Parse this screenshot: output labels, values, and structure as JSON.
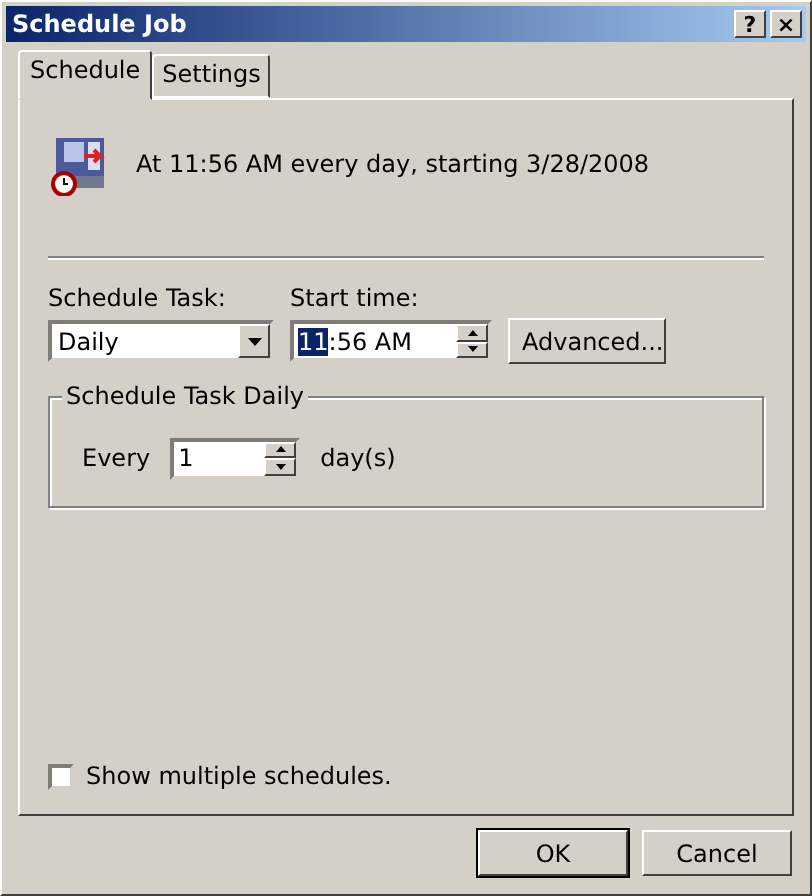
{
  "window": {
    "title": "Schedule Job",
    "title_buttons": [
      "?",
      "×"
    ]
  },
  "tabs": [
    {
      "label": "Schedule",
      "selected": true
    },
    {
      "label": "Settings",
      "selected": false
    }
  ],
  "summary": "At 11:56 AM every day, starting 3/28/2008",
  "schedule_task": {
    "label": "Schedule Task:",
    "value": "Daily"
  },
  "start_time": {
    "label": "Start time:",
    "selected_text": "11",
    "rest_text": ":56 AM"
  },
  "advanced_button": "Advanced...",
  "group": {
    "title": "Schedule Task Daily",
    "every_label": "Every",
    "every_value": "1",
    "unit": "day(s)"
  },
  "multiple_schedules": {
    "label": "Show multiple schedules.",
    "checked": false
  },
  "buttons": [
    "OK",
    "Cancel"
  ]
}
